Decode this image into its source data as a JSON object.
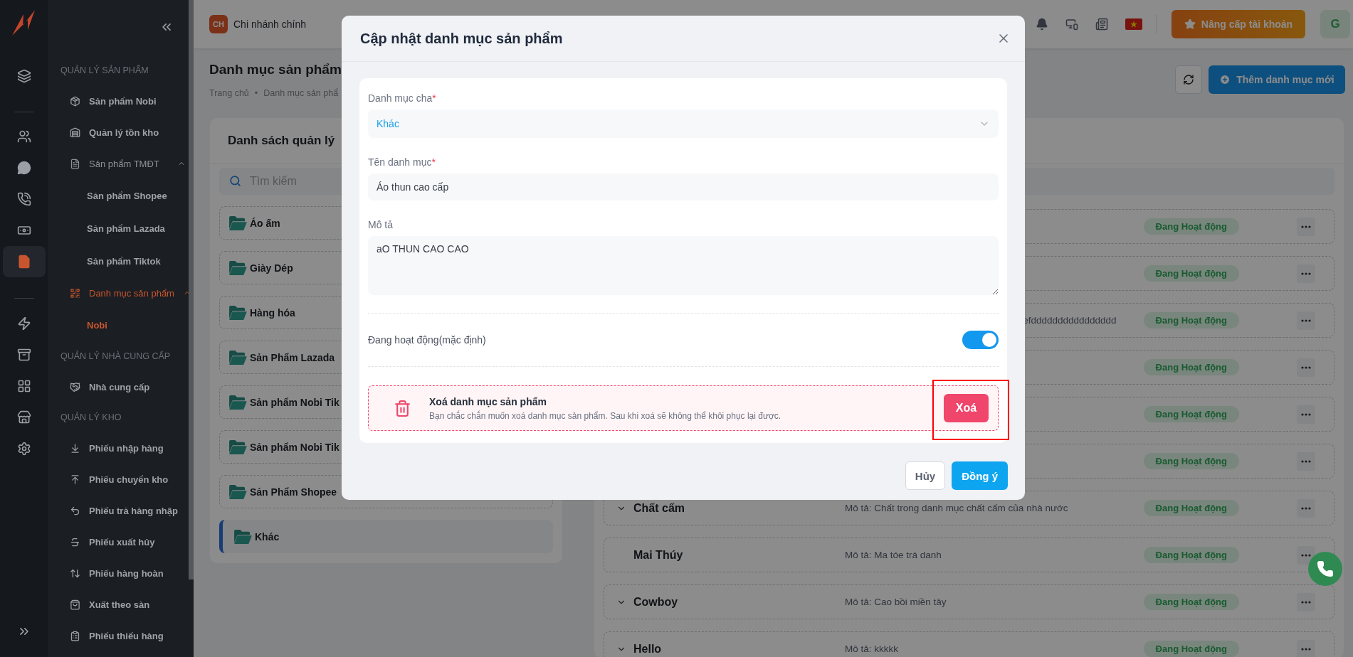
{
  "sidebar": {
    "rail": [
      {
        "kind": "layers",
        "selected": false
      },
      {
        "kind": "divider"
      },
      {
        "kind": "users",
        "selected": false
      },
      {
        "kind": "chat",
        "selected": false
      },
      {
        "kind": "phone",
        "selected": false
      },
      {
        "kind": "money",
        "selected": false
      },
      {
        "kind": "document",
        "selected": true
      },
      {
        "kind": "divider"
      },
      {
        "kind": "bolt",
        "selected": false
      },
      {
        "kind": "archive",
        "selected": false
      },
      {
        "kind": "grid",
        "selected": false
      },
      {
        "kind": "store",
        "selected": false
      },
      {
        "kind": "settings",
        "selected": false
      }
    ],
    "sections": [
      {
        "title": "QUẢN LÝ SẢN PHẨM",
        "items": [
          {
            "kind": "box",
            "label": "Sản phẩm Nobi",
            "selected": false
          },
          {
            "kind": "stock",
            "label": "Quản lý tồn kho",
            "selected": false
          },
          {
            "kind": "document",
            "label": "Sản phẩm TMĐT",
            "selected": false,
            "expanded": true,
            "children": [
              {
                "label": "Sản phẩm Shopee",
                "selected": false
              },
              {
                "label": "Sản phẩm Lazada",
                "selected": false
              },
              {
                "label": "Sản phẩm Tiktok",
                "selected": false
              }
            ]
          },
          {
            "kind": "category",
            "label": "Danh mục sản phẩm",
            "selected": true,
            "expanded": true,
            "children": [
              {
                "label": "Nobi",
                "selected": true
              }
            ]
          }
        ]
      },
      {
        "title": "QUẢN LÝ NHÀ CUNG CẤP",
        "items": [
          {
            "kind": "handshake",
            "label": "Nhà cung cấp",
            "selected": false
          }
        ]
      },
      {
        "title": "QUẢN LÝ KHO",
        "items": [
          {
            "kind": "import",
            "label": "Phiếu nhập hàng",
            "selected": false
          },
          {
            "kind": "transfer",
            "label": "Phiếu chuyển kho",
            "selected": false
          },
          {
            "kind": "return",
            "label": "Phiếu trả hàng nhập",
            "selected": false
          },
          {
            "kind": "cancel",
            "label": "Phiếu xuất hủy",
            "selected": false
          },
          {
            "kind": "refund",
            "label": "Phiếu hàng hoàn",
            "selected": false
          },
          {
            "kind": "export",
            "label": "Xuất theo sàn",
            "selected": false
          },
          {
            "kind": "shortage",
            "label": "Phiếu thiếu hàng",
            "selected": false
          }
        ]
      }
    ]
  },
  "topbar": {
    "branch_badge": "CH",
    "branch": "Chi nhánh chính",
    "upgrade_button": "Nâng cấp tài khoản",
    "avatar": "G"
  },
  "page": {
    "title": "Danh mục sản phẩm",
    "breadcrumb": [
      "Trang chủ",
      "Danh mục sản phẩ"
    ],
    "breadcrumb_separator": "•"
  },
  "left_card": {
    "title": "Danh sách quản lý",
    "search": {
      "placeholder": "Tìm kiếm"
    },
    "folders": [
      {
        "name": "Áo ấm",
        "selected": false
      },
      {
        "name": "Giày Dép",
        "selected": false
      },
      {
        "name": "Hàng hóa",
        "selected": false
      },
      {
        "name": "Sản Phẩm Lazada",
        "selected": false
      },
      {
        "name": "Sản phẩm Nobi Tik",
        "selected": false
      },
      {
        "name": "Sản phẩm Nobi Tik",
        "selected": false
      },
      {
        "name": "Sản Phẩm Shopee",
        "selected": false
      },
      {
        "name": "Khác",
        "selected": true
      }
    ]
  },
  "right_list": {
    "rows": [
      {
        "status": "Đang Hoạt động"
      },
      {
        "status": "Đang Hoạt động"
      },
      {
        "description": "efdddddddddddddddd",
        "status": "Đang Hoạt động"
      },
      {
        "status": "Đang Hoạt động"
      },
      {
        "status": "Đang Hoạt động"
      },
      {
        "status": "Đang Hoạt động"
      },
      {
        "name": "Chất cấm",
        "expandable": true,
        "description": "Mô tả: Chất trong danh mục chất cấm của nhà nước",
        "status": "Đang Hoạt động"
      },
      {
        "name": "Mai Thúy",
        "expandable": false,
        "description": "Mô tả: Ma tóe trá danh",
        "status": "Đang Hoạt động"
      },
      {
        "name": "Cowboy",
        "expandable": true,
        "description": "Mô tả: Cao bồi miền tây",
        "status": "Đang Hoạt động"
      },
      {
        "name": "Hello",
        "expandable": true,
        "description": "Mô tả: kkkkk",
        "status": "Đang Hoạt động"
      }
    ]
  },
  "header_buttons": {
    "add": "Thêm danh mục mới"
  },
  "modal": {
    "title": "Cập nhật danh mục sản phẩm",
    "fields": [
      {
        "kind": "select",
        "label": "Danh mục cha",
        "required_mark": "*",
        "value": "Khác"
      },
      {
        "kind": "text",
        "label": "Tên danh mục",
        "required_mark": "*",
        "value": "Áo thun cao cấp"
      },
      {
        "kind": "textarea",
        "label": "Mô tả",
        "value": "aO THUN CAO CAO"
      }
    ],
    "active_toggle": {
      "label": "Đang hoạt động(mặc định)",
      "on": true
    },
    "danger": {
      "title": "Xoá danh mục sản phẩm",
      "text": "Bạn chắc chắn muốn xoá danh mục sản phẩm. Sau khi xoá sẽ không thể khôi phục lại được.",
      "button": "Xoá",
      "highlighted": true
    },
    "buttons": [
      {
        "kind": "secondary",
        "label": "Hủy"
      },
      {
        "kind": "primary",
        "label": "Đồng ý"
      }
    ]
  }
}
